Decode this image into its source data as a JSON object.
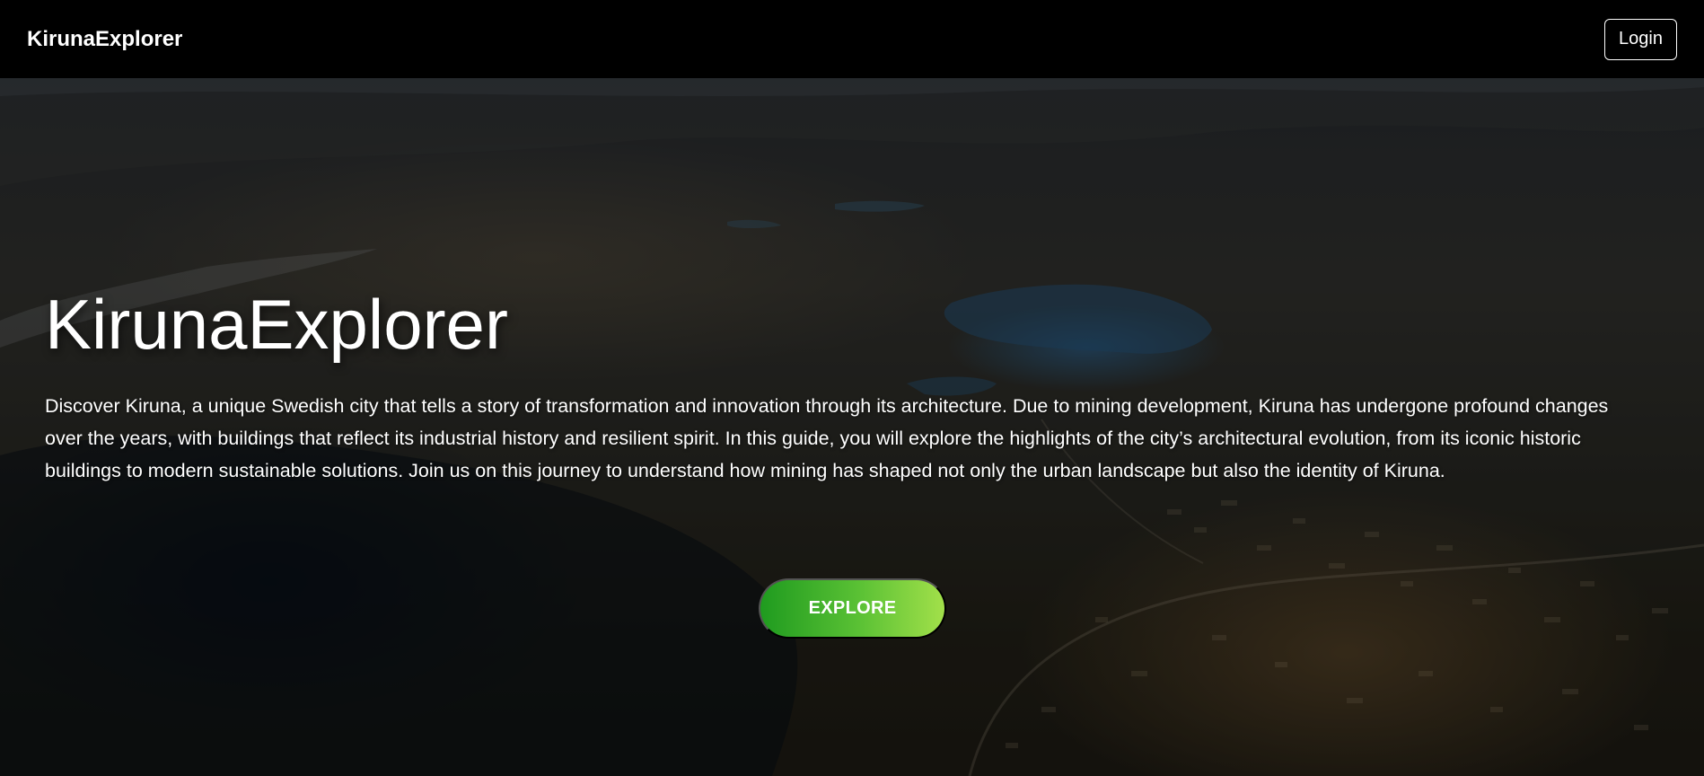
{
  "navbar": {
    "brand": "KirunaExplorer",
    "login_label": "Login"
  },
  "hero": {
    "title": "KirunaExplorer",
    "description": "Discover Kiruna, a unique Swedish city that tells a story of transformation and innovation through its architecture. Due to mining development, Kiruna has undergone profound changes over the years, with buildings that reflect its industrial history and resilient spirit. In this guide, you will explore the highlights of the city’s architectural evolution, from its iconic historic buildings to modern sustainable solutions. Join us on this journey to understand how mining has shaped not only the urban landscape but also the identity of Kiruna.",
    "explore_label": "EXPLORE",
    "background_image": "aerial-landscape-of-kiruna"
  },
  "colors": {
    "navbar_background": "#000000",
    "text": "#ffffff",
    "button_gradient_start": "#1f9b1f",
    "button_gradient_end": "#a2e04a"
  }
}
